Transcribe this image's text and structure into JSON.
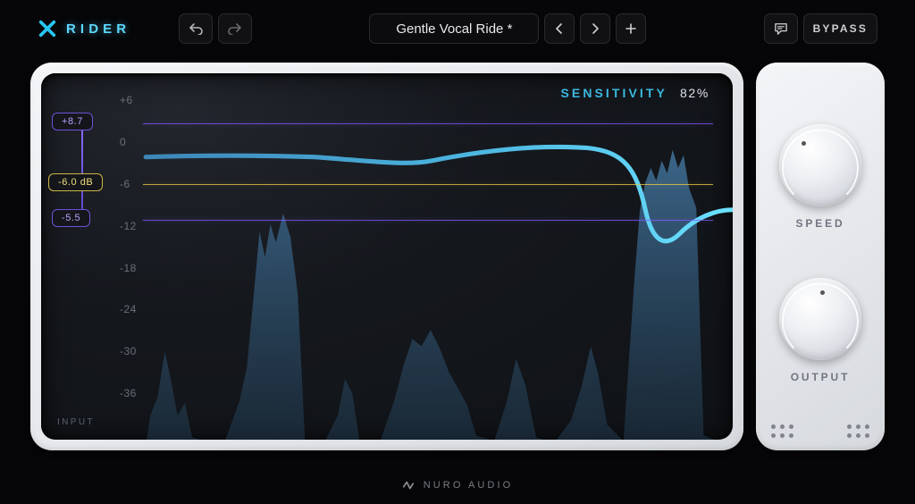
{
  "brand": {
    "name": "RIDER",
    "accent": "#5cd8ff"
  },
  "toolbar": {
    "preset_name": "Gentle Vocal Ride *",
    "bypass_label": "BYPASS"
  },
  "display": {
    "sensitivity_label": "SENSITIVITY",
    "sensitivity_value": "82%",
    "input_label": "INPUT",
    "axis_ticks": [
      "+6",
      "0",
      "-6",
      "-12",
      "-18",
      "-24",
      "-30",
      "-36"
    ],
    "range_high": "+8.7",
    "range_low": "-5.5",
    "target": "-6.0 dB"
  },
  "knobs": {
    "speed_label": "SPEED",
    "output_label": "OUTPUT"
  },
  "footer": {
    "vendor": "NURO AUDIO"
  },
  "chart_data": {
    "type": "line",
    "ylabel": "dB",
    "ylim": [
      -40,
      8
    ],
    "range_high_db": 8.7,
    "range_low_db": -5.5,
    "target_db": -6.0,
    "gain_curve_db": [
      0.5,
      0.6,
      0.6,
      0.5,
      0.5,
      0.3,
      -0.2,
      -0.8,
      0.0,
      1.0,
      1.4,
      1.2,
      0.6,
      -1.0,
      -5.0,
      -8.0,
      -7.0,
      -4.5,
      -4.8
    ],
    "input_level_db": [
      -40,
      -40,
      -32,
      -24,
      -36,
      -40,
      -38,
      -18,
      -10,
      -12,
      -40,
      -38,
      -30,
      -34,
      -40,
      -36,
      -30,
      -26,
      -28,
      -30,
      -28,
      -33,
      -36,
      -40,
      -32,
      -24,
      -30,
      -40,
      -14,
      -5,
      -3,
      -4,
      -2,
      -8,
      -40
    ]
  }
}
